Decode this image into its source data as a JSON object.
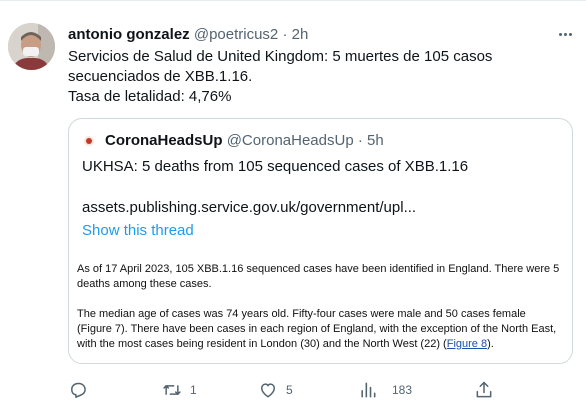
{
  "tweet": {
    "author_name": "antonio gonzalez",
    "author_handle": "@poetricus2",
    "separator": "·",
    "time": "2h",
    "text_lines": [
      "Servicios de Salud de United Kingdom: 5 muertes de 105 casos",
      "secuenciados de XBB.1.16.",
      "Tasa de letalidad: 4,76%"
    ]
  },
  "quote": {
    "author_name": "CoronaHeadsUp",
    "author_handle": "@CoronaHeadsUp",
    "separator": "·",
    "time": "5h",
    "text": "UKHSA: 5 deaths from 105 sequenced cases of XBB.1.16",
    "link": "assets.publishing.service.gov.uk/government/upl...",
    "show_thread": "Show this thread",
    "document": {
      "paragraph1": "As of 17 April 2023, 105 XBB.1.16 sequenced cases have been identified in England. There were 5 deaths among these cases.",
      "paragraph2": "The median age of cases was 74 years old. Fifty-four cases were male and 50 cases female (Figure 7). There have been cases in each region of England, with the exception of the North East, with the most cases being resident in London (30) and the North West (22) (",
      "figure_link": "Figure 8",
      "paragraph2_end": ")."
    }
  },
  "actions": {
    "reply_count": "",
    "retweet_count": "1",
    "like_count": "5",
    "views_count": "183"
  },
  "icons": {
    "reply": "reply-icon",
    "retweet": "retweet-icon",
    "like": "heart-icon",
    "views": "views-icon",
    "share": "share-icon",
    "more": "more-icon"
  },
  "colors": {
    "text": "#0f1419",
    "muted": "#536471",
    "link": "#1d9bf0",
    "border": "#cfd9de"
  }
}
